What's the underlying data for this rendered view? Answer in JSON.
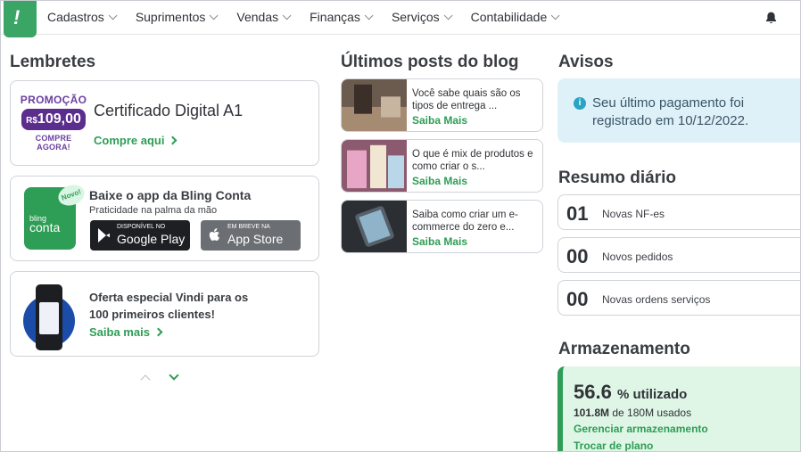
{
  "nav": {
    "logo_glyph": "!",
    "items": [
      {
        "label": "Cadastros"
      },
      {
        "label": "Suprimentos"
      },
      {
        "label": "Vendas"
      },
      {
        "label": "Finanças"
      },
      {
        "label": "Serviços"
      },
      {
        "label": "Contabilidade"
      }
    ],
    "bell_icon": "bell-icon"
  },
  "lembretes": {
    "title": "Lembretes",
    "promo": {
      "badge_top": "PROMOÇÃO",
      "badge_currency": "R$",
      "badge_price": "109,00",
      "badge_bottom": "COMPRE AGORA!",
      "title": "Certificado Digital A1",
      "link": "Compre aqui"
    },
    "app": {
      "new_badge": "Novo!",
      "art_brand": "bling",
      "art_name": "conta",
      "title": "Baixe o app da Bling Conta",
      "subtitle": "Praticidade na palma da mão",
      "google_small": "DISPONÍVEL NO",
      "google_large": "Google Play",
      "apple_small": "EM BREVE NA",
      "apple_large": "App Store"
    },
    "vindi": {
      "title": "Oferta especial Vindi para os 100 primeiros clientes!",
      "link": "Saiba mais"
    }
  },
  "blog": {
    "title": "Últimos posts do blog",
    "posts": [
      {
        "text": "Você sabe quais são os tipos de entrega ...",
        "link": "Saiba Mais"
      },
      {
        "text": "O que é mix de produtos e como criar o s...",
        "link": "Saiba Mais"
      },
      {
        "text": "Saiba como criar um e-commerce do zero e...",
        "link": "Saiba Mais"
      }
    ]
  },
  "avisos": {
    "title": "Avisos",
    "info_glyph": "i",
    "message": "Seu último pagamento foi registrado em 10/12/2022."
  },
  "resumo": {
    "title": "Resumo diário",
    "items": [
      {
        "num": "01",
        "label": "Novas NF-es"
      },
      {
        "num": "00",
        "label": "Novos pedidos"
      },
      {
        "num": "00",
        "label": "Novas ordens serviços"
      }
    ]
  },
  "armazenamento": {
    "title": "Armazenamento",
    "percent": "56.6",
    "percent_suffix": "% utilizado",
    "used_amount": "101.8M",
    "used_rest": "de 180M usados",
    "manage_link": "Gerenciar armazenamento",
    "plan_link": "Trocar de plano"
  },
  "colors": {
    "brand_green": "#2e9d55",
    "promo_purple": "#5b2d8c",
    "info_bg": "#dff1f8",
    "storage_bg": "#dff6e6"
  }
}
